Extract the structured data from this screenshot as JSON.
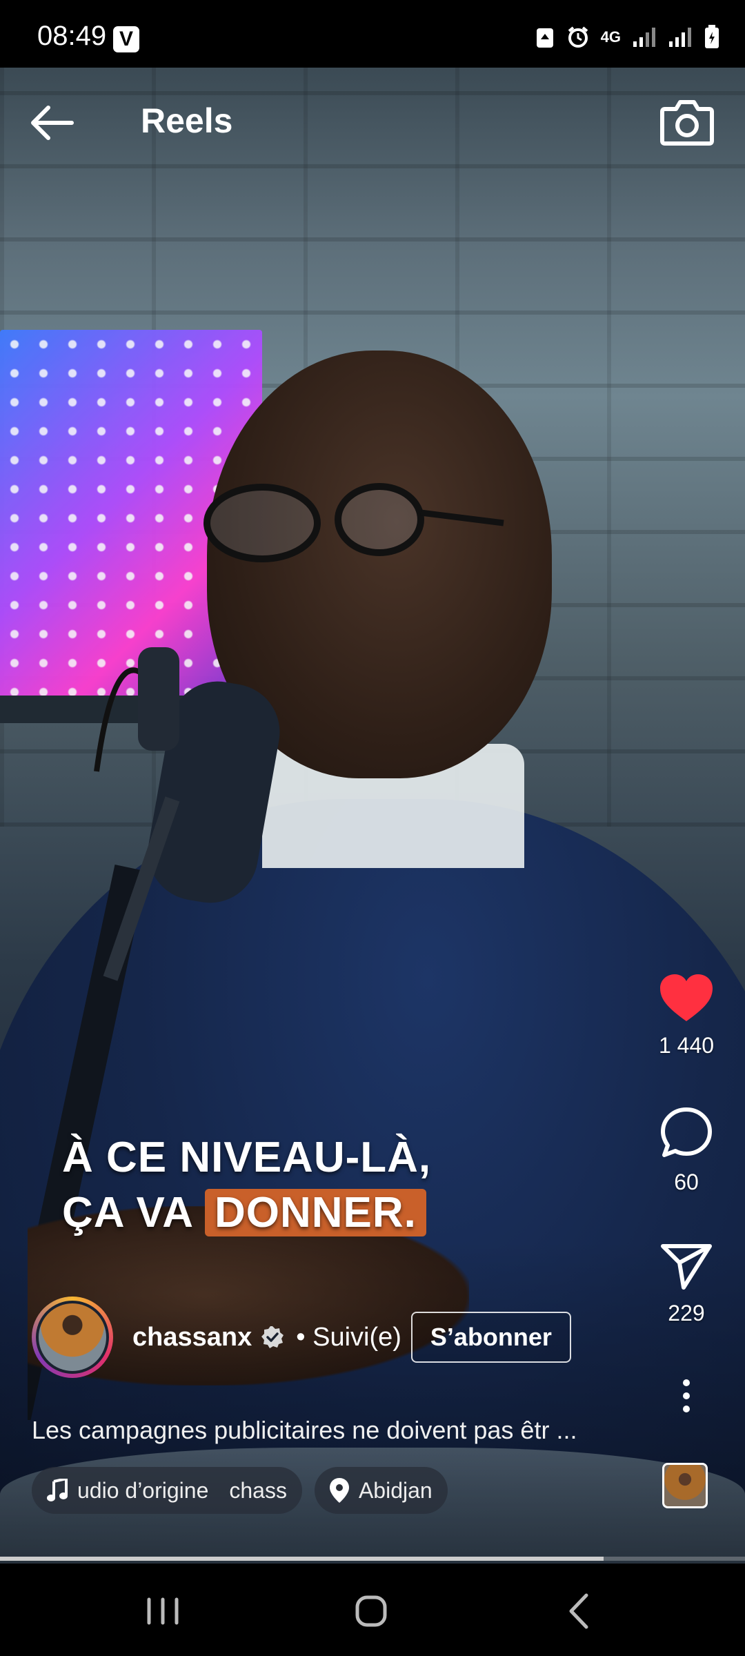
{
  "status_bar": {
    "time": "08:49",
    "app_badge": "V",
    "network": "4G"
  },
  "header": {
    "title": "Reels",
    "back_icon": "arrow-left-icon",
    "camera_icon": "camera-icon"
  },
  "video_caption": {
    "line1": "À CE NIVEAU-LÀ,",
    "line2_prefix": "ÇA VA",
    "line2_highlight": "DONNER."
  },
  "actions": {
    "likes": "1 440",
    "comments": "60",
    "shares": "229",
    "like_color": "#ff3040"
  },
  "author": {
    "username": "chassanx",
    "followed_label": "• Suivi(e)",
    "subscribe_label": "S’abonner"
  },
  "description": "Les campagnes publicitaires ne doivent pas êtr ...",
  "chips": {
    "audio_label": "udio d’origine",
    "audio_author": "chass",
    "location": "Abidjan"
  },
  "progress": 0.81
}
